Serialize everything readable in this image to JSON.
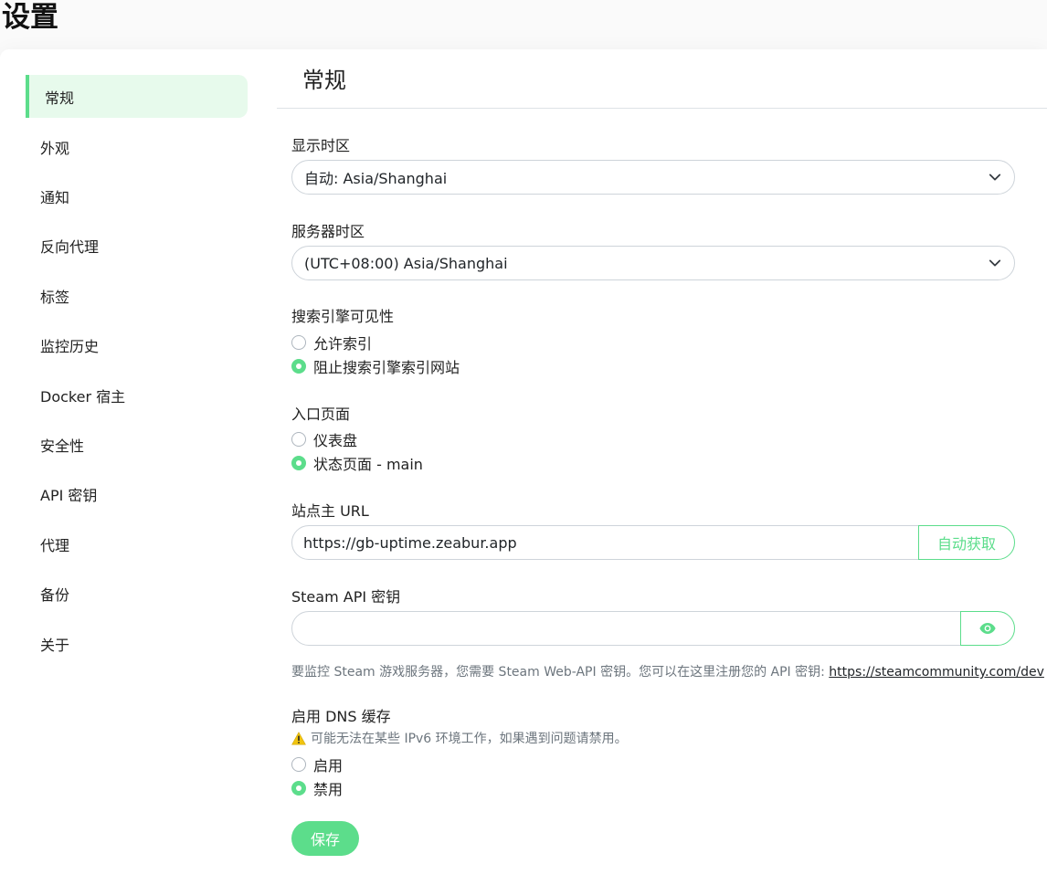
{
  "page": {
    "title": "设置"
  },
  "sidebar": {
    "items": [
      {
        "label": "常规",
        "active": true
      },
      {
        "label": "外观"
      },
      {
        "label": "通知"
      },
      {
        "label": "反向代理"
      },
      {
        "label": "标签"
      },
      {
        "label": "监控历史"
      },
      {
        "label": "Docker 宿主"
      },
      {
        "label": "安全性"
      },
      {
        "label": "API 密钥"
      },
      {
        "label": "代理"
      },
      {
        "label": "备份"
      },
      {
        "label": "关于"
      }
    ]
  },
  "main": {
    "title": "常规",
    "display_timezone": {
      "label": "显示时区",
      "value": "自动: Asia/Shanghai"
    },
    "server_timezone": {
      "label": "服务器时区",
      "value": "(UTC+08:00) Asia/Shanghai"
    },
    "search_visibility": {
      "label": "搜索引擎可见性",
      "options": [
        {
          "label": "允许索引",
          "checked": false
        },
        {
          "label": "阻止搜索引擎索引网站",
          "checked": true
        }
      ]
    },
    "entry_page": {
      "label": "入口页面",
      "options": [
        {
          "label": "仪表盘",
          "checked": false
        },
        {
          "label": "状态页面 - main",
          "checked": true
        }
      ]
    },
    "primary_url": {
      "label": "站点主 URL",
      "value": "https://gb-uptime.zeabur.app",
      "auto_button": "自动获取"
    },
    "steam_api": {
      "label": "Steam API 密钥",
      "value": "",
      "help_text": "要监控 Steam 游戏服务器，您需要 Steam Web-API 密钥。您可以在这里注册您的 API 密钥: ",
      "help_link": "https://steamcommunity.com/dev"
    },
    "dns_cache": {
      "label": "启用 DNS 缓存",
      "warning": "可能无法在某些 IPv6 环境工作，如果遇到问题请禁用。",
      "options": [
        {
          "label": "启用",
          "checked": false
        },
        {
          "label": "禁用",
          "checked": true
        }
      ]
    },
    "save_label": "保存"
  },
  "colors": {
    "accent": "#5cdd8b",
    "active_bg": "#e7faec",
    "warning": "#f1c40f"
  }
}
